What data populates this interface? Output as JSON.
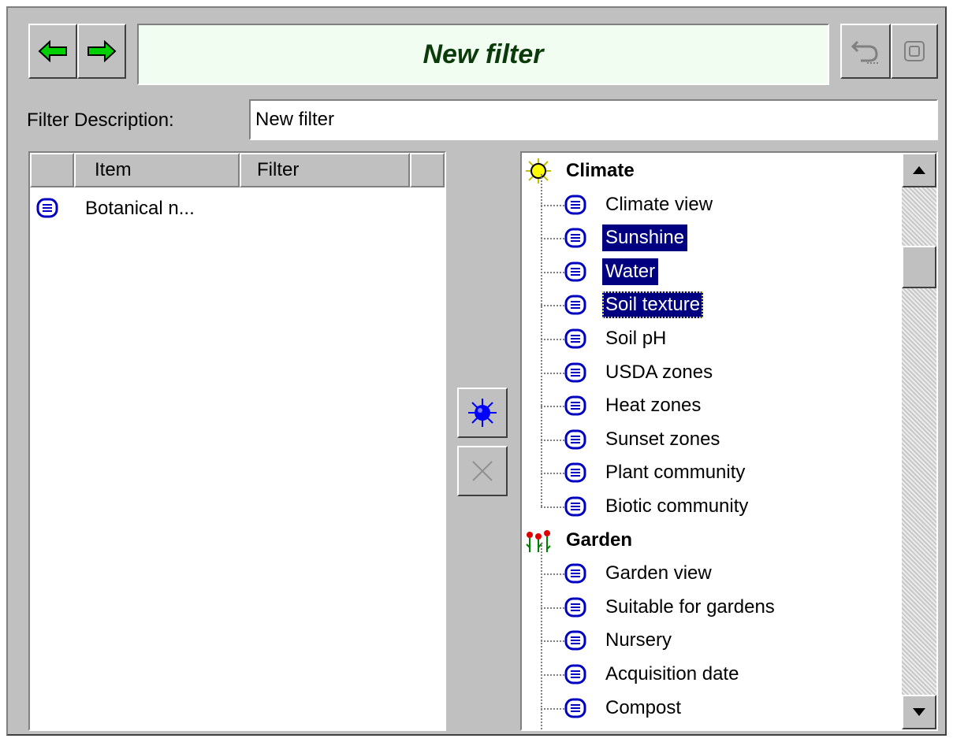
{
  "header": {
    "back_label": "back-arrow",
    "forward_label": "forward-arrow",
    "title": "New filter",
    "undo_icon": "undo-icon",
    "stop_icon": "stop-icon"
  },
  "description": {
    "label": "Filter Description:",
    "value": "New filter"
  },
  "left_table": {
    "columns": [
      "",
      "Item",
      "Filter"
    ],
    "rows": [
      {
        "icon": "list-icon",
        "item": "Botanical n...",
        "filter": ""
      }
    ]
  },
  "middle_buttons": {
    "add_icon": "blue-star-icon",
    "remove_icon": "x-icon"
  },
  "tree": {
    "groups": [
      {
        "name": "Climate",
        "icon": "sun-icon",
        "items": [
          {
            "label": "Climate view",
            "selected": false
          },
          {
            "label": "Sunshine",
            "selected": true
          },
          {
            "label": "Water",
            "selected": true
          },
          {
            "label": "Soil texture",
            "selected": true,
            "focused": true
          },
          {
            "label": "Soil pH",
            "selected": false
          },
          {
            "label": "USDA zones",
            "selected": false
          },
          {
            "label": "Heat zones",
            "selected": false
          },
          {
            "label": "Sunset zones",
            "selected": false
          },
          {
            "label": "Plant community",
            "selected": false
          },
          {
            "label": "Biotic community",
            "selected": false
          }
        ]
      },
      {
        "name": "Garden",
        "icon": "flowers-icon",
        "items": [
          {
            "label": "Garden view",
            "selected": false
          },
          {
            "label": "Suitable for gardens",
            "selected": false
          },
          {
            "label": "Nursery",
            "selected": false
          },
          {
            "label": "Acquisition date",
            "selected": false
          },
          {
            "label": "Compost",
            "selected": false
          }
        ]
      }
    ]
  },
  "colors": {
    "selection": "#000080",
    "title_bg": "#f0fdf0",
    "title_text": "#0b3b0b",
    "arrow_green": "#00c000",
    "node_icon_blue": "#0000c0"
  }
}
